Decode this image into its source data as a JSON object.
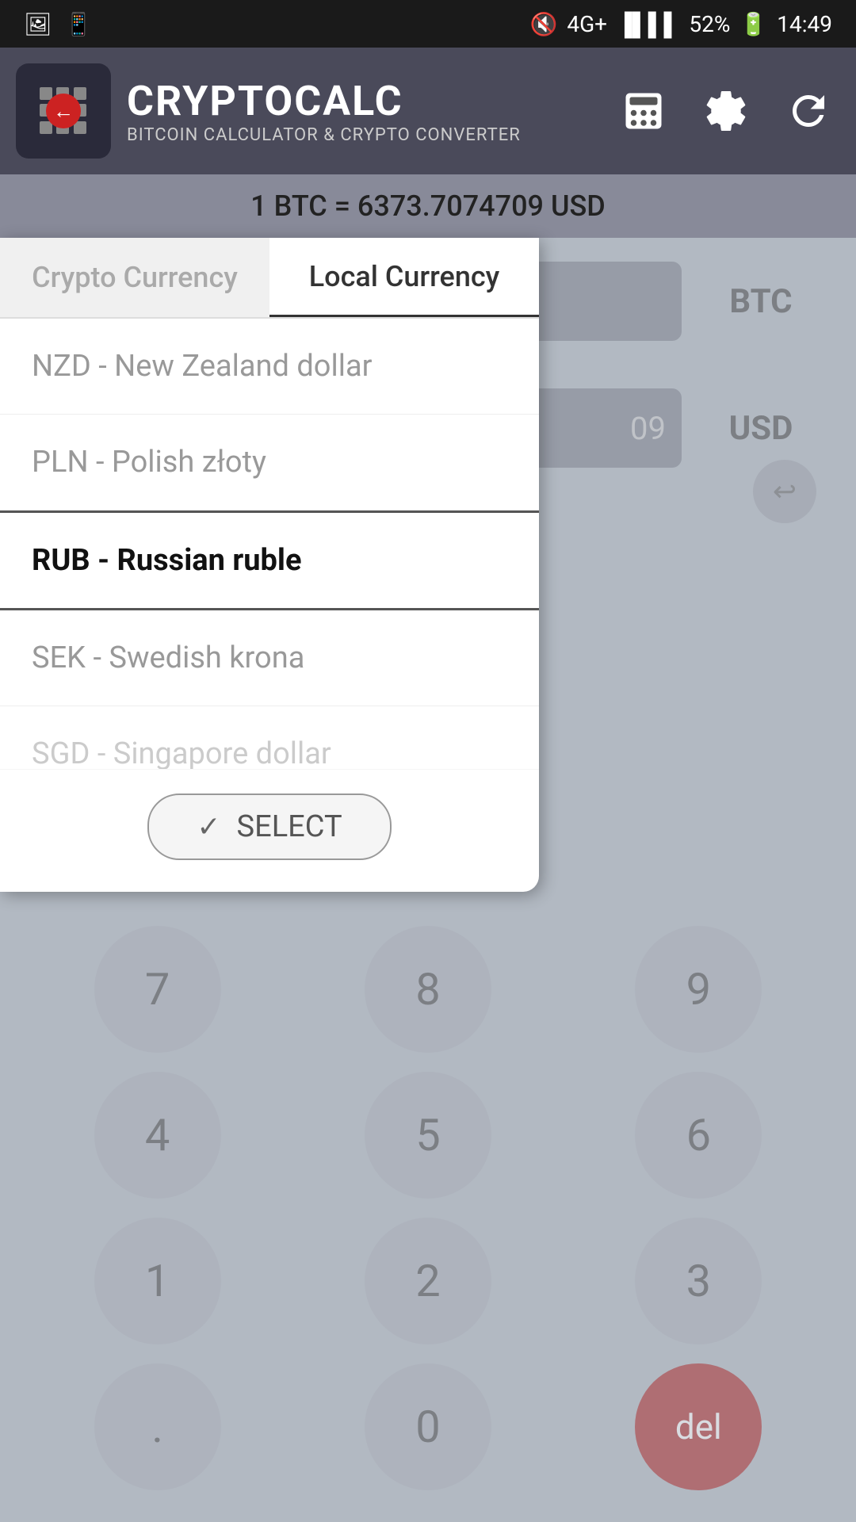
{
  "statusBar": {
    "icons_left": [
      "image-icon",
      "phone-icon"
    ],
    "mute": "🔇",
    "network": "4G+",
    "signal": "📶",
    "battery": "52%",
    "time": "14:49"
  },
  "header": {
    "appName": "CRYPTOCALC",
    "subtitle": "BITCOIN CALCULATOR & CRYPTO CONVERTER",
    "buttons": [
      "calculator-icon",
      "settings-icon",
      "refresh-icon"
    ]
  },
  "rateBar": {
    "text": "1 BTC = 6373.7074709 USD"
  },
  "display": {
    "btcLabel": "BTC",
    "usdLabel": "USD"
  },
  "modal": {
    "tabs": [
      {
        "id": "crypto",
        "label": "Crypto Currency",
        "active": false
      },
      {
        "id": "local",
        "label": "Local Currency",
        "active": true
      }
    ],
    "currencies": [
      {
        "id": "nzd",
        "code": "NZD",
        "name": "New Zealand dollar",
        "selected": false
      },
      {
        "id": "pln",
        "code": "PLN",
        "name": "Polish złoty",
        "selected": false
      },
      {
        "id": "rub",
        "code": "RUB",
        "name": "Russian ruble",
        "selected": true
      },
      {
        "id": "sek",
        "code": "SEK",
        "name": "Swedish krona",
        "selected": false
      },
      {
        "id": "sgd",
        "code": "SGD",
        "name": "Singapore dollar",
        "selected": false,
        "partial": true
      }
    ],
    "selectButton": "SELECT"
  },
  "numpad": {
    "keys": [
      "7",
      "8",
      "9",
      "4",
      "5",
      "6",
      "1",
      "2",
      "3",
      ".",
      "0",
      "del"
    ]
  }
}
